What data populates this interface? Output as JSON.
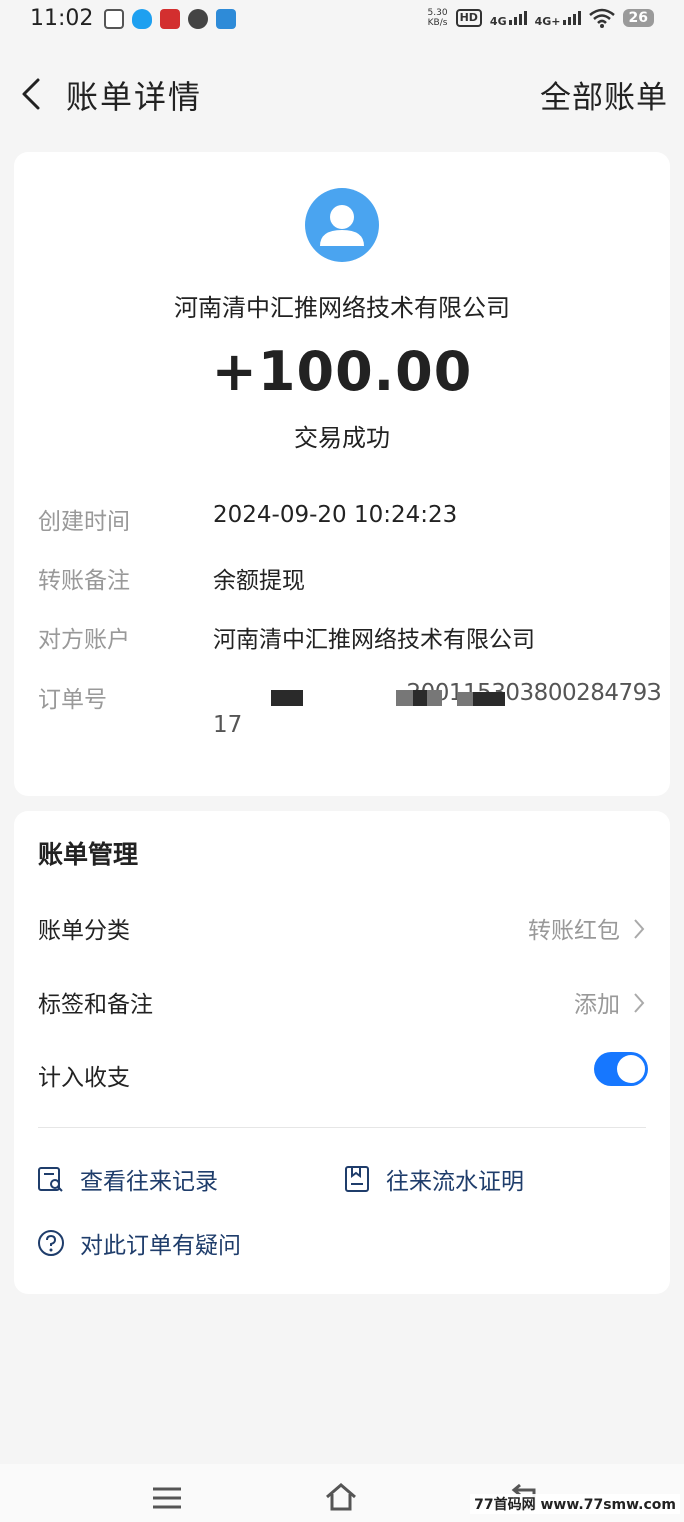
{
  "status_bar": {
    "time": "11:02",
    "speed_value": "5.30",
    "speed_unit": "KB/s",
    "hd_label": "HD",
    "network_1": "4G",
    "network_2": "4G+",
    "battery": "26",
    "app_icons": [
      "app-icon-1",
      "qq-icon",
      "app-icon-3",
      "chat-icon",
      "app-icon-5"
    ]
  },
  "header": {
    "title": "账单详情",
    "all_bills": "全部账单"
  },
  "transaction": {
    "counterparty": "河南清中汇推网络技术有限公司",
    "amount": "+100.00",
    "status": "交易成功"
  },
  "details": [
    {
      "label": "创建时间",
      "value": "2024-09-20 10:24:23"
    },
    {
      "label": "转账备注",
      "value": "余额提现"
    },
    {
      "label": "对方账户",
      "value": "河南清中汇推网络技术有限公司"
    },
    {
      "label": "订单号",
      "value_line1": "20011530380028479З",
      "value_line2": "17"
    }
  ],
  "management": {
    "title": "账单管理",
    "category_label": "账单分类",
    "category_value": "转账红包",
    "tags_label": "标签和备注",
    "tags_value": "添加",
    "count_label": "计入收支",
    "count_toggle_on": true,
    "links": {
      "history": "查看往来记录",
      "certificate": "往来流水证明",
      "question": "对此订单有疑问"
    }
  },
  "watermark": "77首码网 www.77smw.com",
  "colors": {
    "accent": "#1677ff",
    "link": "#1f3d6b",
    "avatar": "#4aa4f0",
    "muted": "#999999",
    "background": "#f5f5f5"
  }
}
